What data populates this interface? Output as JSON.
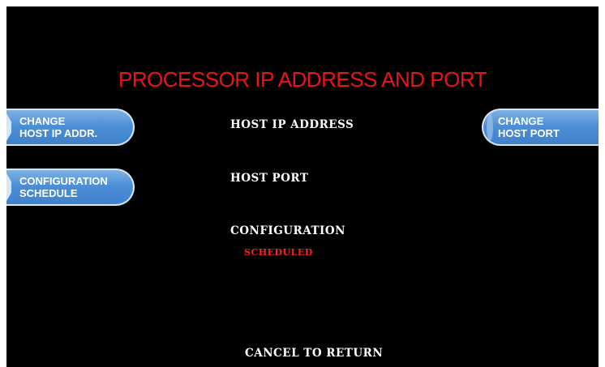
{
  "screen": {
    "title": "PROCESSOR IP ADDRESS AND PORT",
    "title_color": "#e8131b",
    "background": "#000000",
    "accent_color": "#4d8fd6"
  },
  "left_keys": [
    {
      "line1": "CHANGE",
      "line2": "HOST IP ADDR."
    },
    {
      "line1": "CONFIGURATION",
      "line2": "SCHEDULE"
    }
  ],
  "right_keys": [
    {
      "line1": "CHANGE",
      "line2": "HOST PORT"
    }
  ],
  "fields": {
    "host_ip_label": "HOST IP ADDRESS",
    "host_port_label": "HOST PORT",
    "configuration_label": "CONFIGURATION",
    "configuration_status": "SCHEDULED",
    "status_color": "#ff2020"
  },
  "footer": {
    "cancel_text": "CANCEL TO RETURN"
  }
}
